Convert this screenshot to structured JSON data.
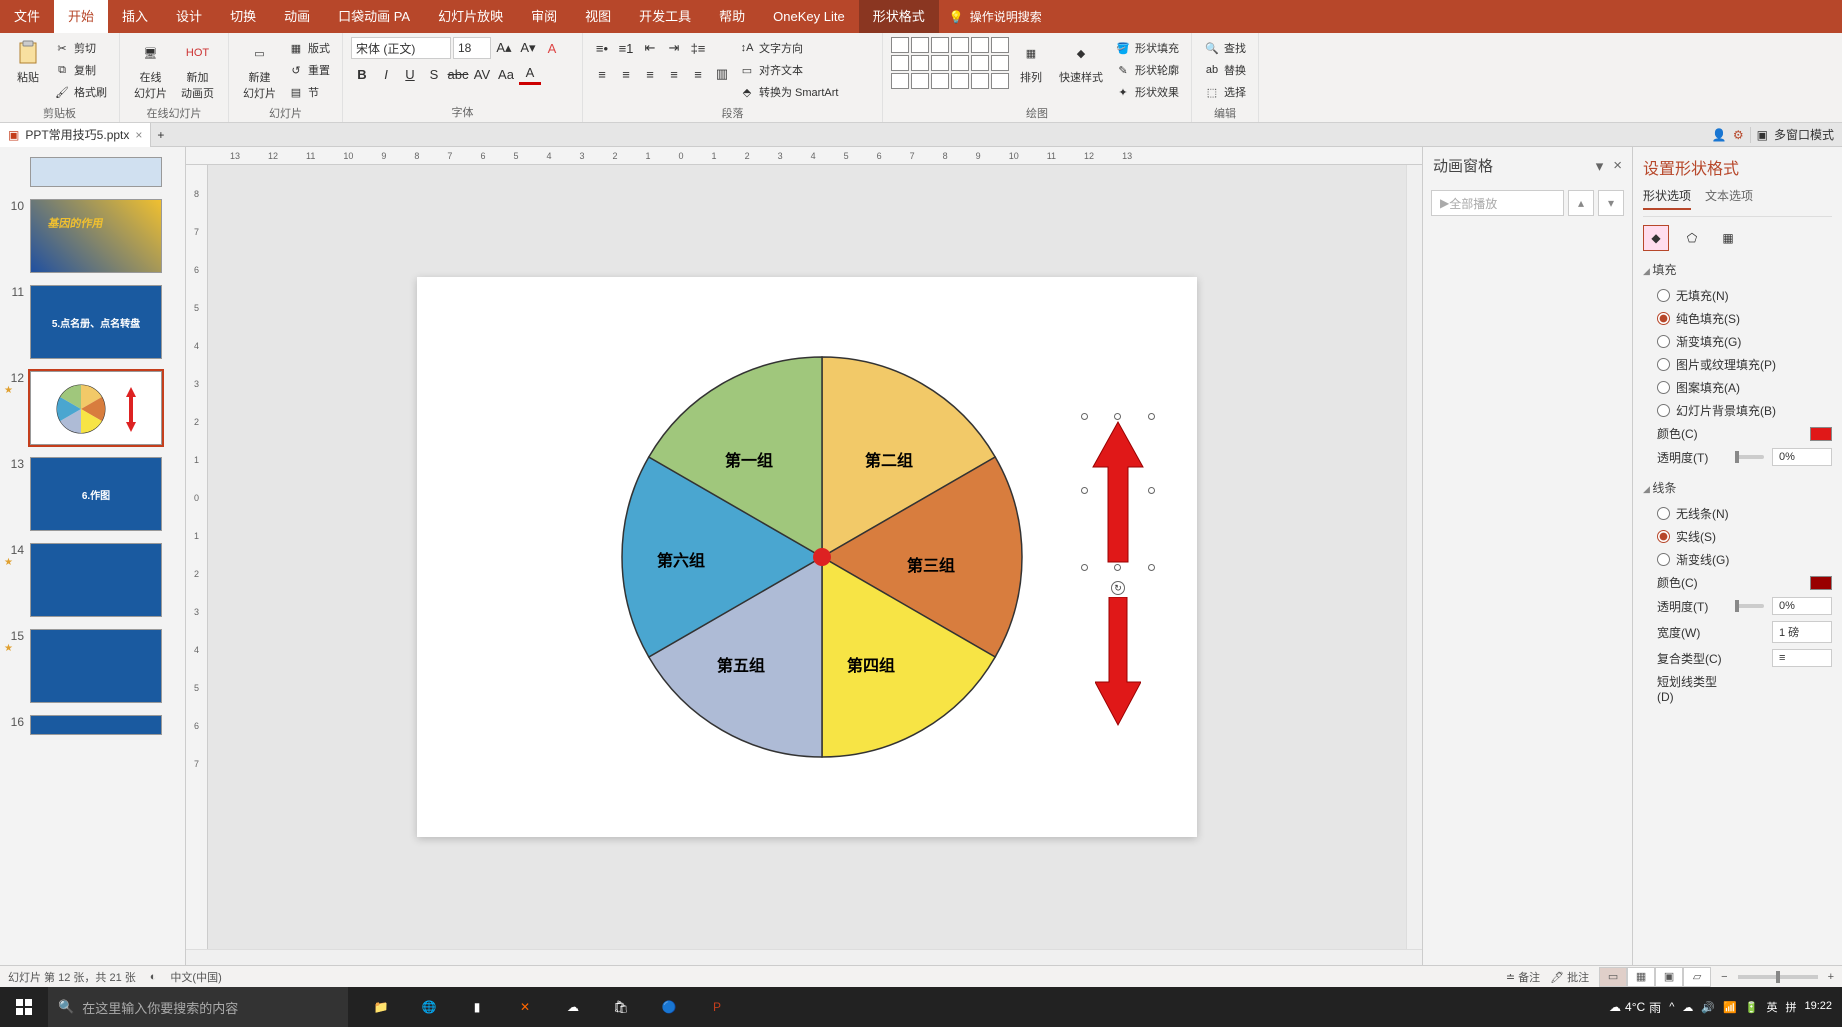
{
  "tabs": {
    "file": "文件",
    "home": "开始",
    "insert": "插入",
    "design": "设计",
    "transition": "切换",
    "animation": "动画",
    "pocket": "口袋动画 PA",
    "slideshow": "幻灯片放映",
    "review": "审阅",
    "view": "视图",
    "devtools": "开发工具",
    "help": "帮助",
    "onekey": "OneKey Lite",
    "shapefmt": "形状格式",
    "search_hint": "操作说明搜索"
  },
  "ribbon": {
    "clipboard": {
      "paste": "粘贴",
      "cut": "剪切",
      "copy": "复制",
      "fmtpaint": "格式刷",
      "label": "剪贴板"
    },
    "online": {
      "onlineslide": "在线\n幻灯片",
      "newanim": "新加\n动画页",
      "label": "在线幻灯片"
    },
    "slides": {
      "newslide": "新建\n幻灯片",
      "layout": "版式",
      "reset": "重置",
      "section": "节",
      "label": "幻灯片"
    },
    "font": {
      "family": "宋体 (正文)",
      "size": "18",
      "label": "字体"
    },
    "para": {
      "textdir": "文字方向",
      "align": "对齐文本",
      "smartart": "转换为 SmartArt",
      "label": "段落"
    },
    "draw": {
      "arrange": "排列",
      "quickstyle": "快速样式",
      "fill": "形状填充",
      "outline": "形状轮廓",
      "effect": "形状效果",
      "label": "绘图"
    },
    "edit": {
      "find": "查找",
      "replace": "替换",
      "select": "选择",
      "label": "编辑"
    }
  },
  "doc": {
    "filename": "PPT常用技巧5.pptx",
    "multiwnd": "多窗口模式"
  },
  "thumbs": {
    "nums": [
      "10",
      "11",
      "12",
      "13",
      "14",
      "15",
      "16"
    ],
    "t11": "5.点名册、点名转盘",
    "t13": "6.作图"
  },
  "chart_data": {
    "type": "pie",
    "title": "",
    "categories": [
      "第一组",
      "第二组",
      "第三组",
      "第四组",
      "第五组",
      "第六组"
    ],
    "values": [
      1,
      1,
      1,
      1,
      1,
      1
    ],
    "colors": [
      "#a0c77c",
      "#f2c968",
      "#d87d3e",
      "#f7e445",
      "#aebbd6",
      "#4aa6d0"
    ],
    "center_dot": "#d22"
  },
  "anim": {
    "title": "动画窗格",
    "playall": "全部播放"
  },
  "fmt": {
    "title": "设置形状格式",
    "tab_shape": "形状选项",
    "tab_text": "文本选项",
    "fill_head": "填充",
    "fill_none": "无填充(N)",
    "fill_solid": "纯色填充(S)",
    "fill_grad": "渐变填充(G)",
    "fill_pic": "图片或纹理填充(P)",
    "fill_pat": "图案填充(A)",
    "fill_bg": "幻灯片背景填充(B)",
    "color": "颜色(C)",
    "trans": "透明度(T)",
    "trans_val": "0%",
    "line_head": "线条",
    "line_none": "无线条(N)",
    "line_solid": "实线(S)",
    "line_grad": "渐变线(G)",
    "line_trans_val": "0%",
    "width": "宽度(W)",
    "width_val": "1 磅",
    "compound": "复合类型(C)",
    "dash": "短划线类型(D)"
  },
  "status": {
    "slide": "幻灯片 第 12 张，共 21 张",
    "lang": "中文(中国)",
    "notes_btn": "备注",
    "comment_btn": "批注"
  },
  "taskbar": {
    "search": "在这里输入你要搜索的内容",
    "weather_temp": "4°C",
    "weather_desc": "雨",
    "ime1": "英",
    "ime2": "拼",
    "time": "19:22"
  }
}
